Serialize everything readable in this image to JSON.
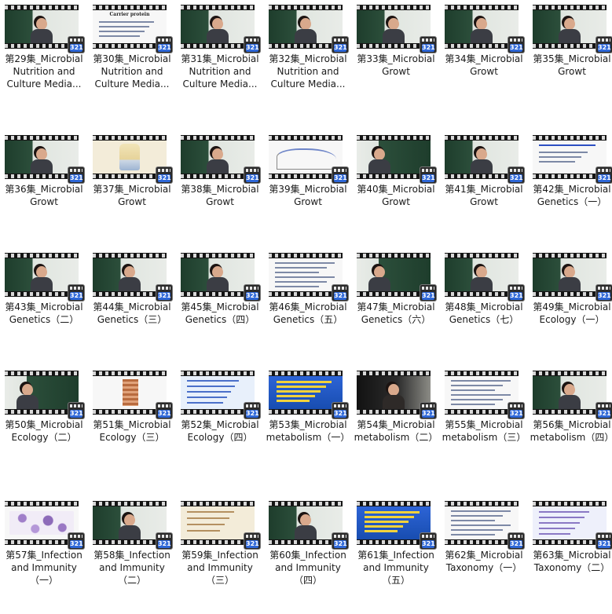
{
  "badge_text": "321",
  "colors": {
    "label_text": "#1a1a1a",
    "badge_blue": "#2f68d8",
    "film": "#141414"
  },
  "videos": [
    {
      "label": "第29集_Microbial Nutrition and Culture Media...",
      "thumb": "classroom",
      "person": "center"
    },
    {
      "label": "第30集_Microbial Nutrition and Culture Media...",
      "thumb": "slide-title",
      "slide_title": "Carrier protein"
    },
    {
      "label": "第31集_Microbial Nutrition and Culture Media...",
      "thumb": "classroom",
      "person": "center"
    },
    {
      "label": "第32集_Microbial Nutrition and Culture Media...",
      "thumb": "classroom",
      "person": "center"
    },
    {
      "label": "第33集_Microbial Growt",
      "thumb": "classroom",
      "person": "center"
    },
    {
      "label": "第34集_Microbial Growt",
      "thumb": "classroom",
      "person": "center"
    },
    {
      "label": "第35集_Microbial Growt",
      "thumb": "classroom",
      "person": "center"
    },
    {
      "label": "第36集_Microbial Growt",
      "thumb": "classroom",
      "person": "center"
    },
    {
      "label": "第37集_Microbial Growt",
      "thumb": "bottle"
    },
    {
      "label": "第38集_Microbial Growt",
      "thumb": "classroom",
      "person": "center"
    },
    {
      "label": "第39集_Microbial Growt",
      "thumb": "chart"
    },
    {
      "label": "第40集_Microbial Growt",
      "thumb": "classroom-mirror",
      "person": "left"
    },
    {
      "label": "第41集_Microbial Growt",
      "thumb": "classroom",
      "person": "center"
    },
    {
      "label": "第42集_Microbial Genetics（一）",
      "thumb": "slide-heading"
    },
    {
      "label": "第43集_Microbial Genetics（二）",
      "thumb": "classroom",
      "person": "center"
    },
    {
      "label": "第44集_Microbial Genetics（三）",
      "thumb": "classroom",
      "person": "center"
    },
    {
      "label": "第45集_Microbial Genetics（四）",
      "thumb": "classroom",
      "person": "center"
    },
    {
      "label": "第46集_Microbial Genetics（五）",
      "thumb": "slide-text"
    },
    {
      "label": "第47集_Microbial Genetics（六）",
      "thumb": "classroom-mirror",
      "person": "left"
    },
    {
      "label": "第48集_Microbial Genetics（七）",
      "thumb": "classroom",
      "person": "center"
    },
    {
      "label": "第49集_Microbial Ecology（一）",
      "thumb": "classroom",
      "person": "center"
    },
    {
      "label": "第50集_Microbial Ecology（二）",
      "thumb": "classroom-mirror",
      "person": "left"
    },
    {
      "label": "第51集_Microbial Ecology（三）",
      "thumb": "tissue"
    },
    {
      "label": "第52集_Microbial Ecology（四）",
      "thumb": "lblue"
    },
    {
      "label": "第53集_Microbial metabolism（一）",
      "thumb": "blue"
    },
    {
      "label": "第54集_Microbial metabolism（二）",
      "thumb": "dark",
      "person": "center"
    },
    {
      "label": "第55集_Microbial metabolism（三）",
      "thumb": "slide-text"
    },
    {
      "label": "第56集_Microbial metabolism（四）",
      "thumb": "classroom",
      "person": "center"
    },
    {
      "label": "第57集_Infection and Immunity（一）",
      "thumb": "cells"
    },
    {
      "label": "第58集_Infection and Immunity（二）",
      "thumb": "classroom",
      "person": "center"
    },
    {
      "label": "第59集_Infection and Immunity（三）",
      "thumb": "cream"
    },
    {
      "label": "第60集_Infection and Immunity（四）",
      "thumb": "classroom",
      "person": "center"
    },
    {
      "label": "第61集_Infection and Immunity（五）",
      "thumb": "blue"
    },
    {
      "label": "第62集_Microbial Taxonomy（一）",
      "thumb": "slide-text"
    },
    {
      "label": "第63集_Microbial Taxonomy（二）",
      "thumb": "lav"
    }
  ]
}
